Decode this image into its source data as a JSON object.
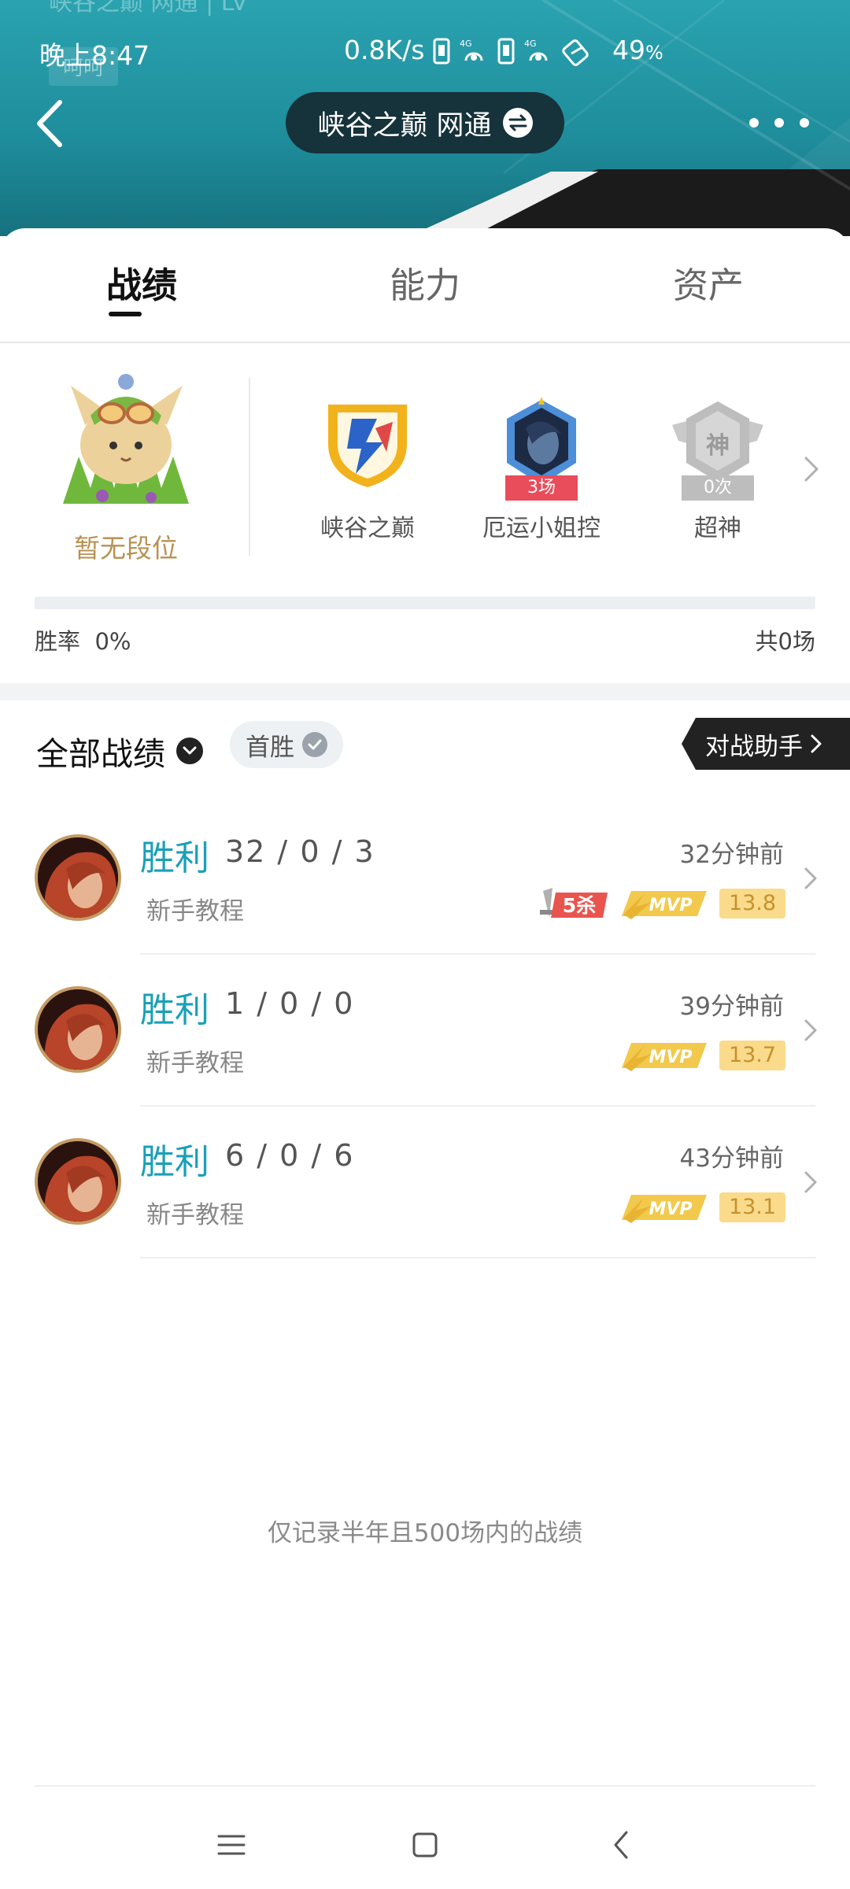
{
  "status_bar": {
    "time": "晚上8:47",
    "speed": "0.8K/s",
    "battery_value": "49",
    "battery_unit": "%"
  },
  "header": {
    "faded_title": "峡谷之巅 网通 | LV",
    "faded_tag": "呵呵",
    "server": "峡谷之巅 网通",
    "icons": [
      "back-arrow",
      "swap-circle",
      "more-dots"
    ]
  },
  "tabs": [
    {
      "label": "战绩",
      "active": true
    },
    {
      "label": "能力",
      "active": false
    },
    {
      "label": "资产",
      "active": false
    }
  ],
  "rank": {
    "label": "暂无段位"
  },
  "badges": [
    {
      "label": "峡谷之巅",
      "count": ""
    },
    {
      "label": "厄运小姐控",
      "count": "3场"
    },
    {
      "label": "超神",
      "count": "0次"
    }
  ],
  "stats": {
    "winrate_label": "胜率",
    "winrate_value": "0%",
    "total": "共0场",
    "progress": 0
  },
  "filter": {
    "title": "全部战绩",
    "chip": "首胜",
    "helper": "对战助手"
  },
  "matches": [
    {
      "result": "胜利",
      "kda": "32 / 0 / 3",
      "mode": "新手教程",
      "time": "32分钟前",
      "kills_tag": "5杀",
      "mvp": "MVP",
      "score": "13.8"
    },
    {
      "result": "胜利",
      "kda": "1 / 0 / 0",
      "mode": "新手教程",
      "time": "39分钟前",
      "kills_tag": "",
      "mvp": "MVP",
      "score": "13.7"
    },
    {
      "result": "胜利",
      "kda": "6 / 0 / 6",
      "mode": "新手教程",
      "time": "43分钟前",
      "kills_tag": "",
      "mvp": "MVP",
      "score": "13.1"
    }
  ],
  "footnote": "仅记录半年且500场内的战绩",
  "colors": {
    "header": "#1e8c9b",
    "win": "#1aa0b8",
    "rank_gold": "#b79254",
    "score_bg": "#fadb8c"
  }
}
